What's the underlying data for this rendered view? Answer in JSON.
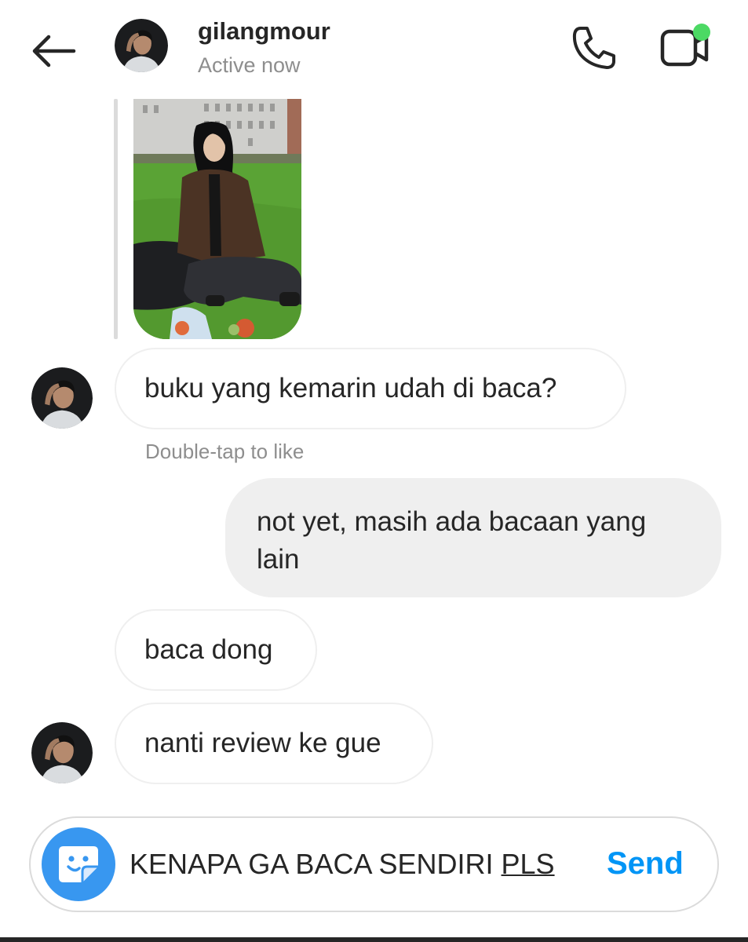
{
  "header": {
    "username": "gilangmour",
    "status": "Active now",
    "icons": {
      "back": "back-arrow-icon",
      "call": "phone-icon",
      "video": "video-camera-icon"
    },
    "online_dot_color": "#4cd964"
  },
  "messages": [
    {
      "sender": "them",
      "type": "image",
      "content": "photo"
    },
    {
      "sender": "them",
      "type": "text",
      "text": "buku yang kemarin udah di baca?"
    },
    {
      "sender": "me",
      "type": "text",
      "text": "not yet, masih ada bacaan yang lain"
    },
    {
      "sender": "them",
      "type": "text",
      "text": "baca dong"
    },
    {
      "sender": "them",
      "type": "text",
      "text": "nanti review ke gue"
    }
  ],
  "hint": "Double-tap to like",
  "composer": {
    "text_main": "KENAPA GA BACA SENDIRI ",
    "text_underlined": "PLS",
    "send_label": "Send",
    "sticker_icon": "sticker-icon"
  },
  "colors": {
    "send_blue": "#0095f6",
    "sticker_blue": "#3897f0",
    "my_bubble": "#efefef",
    "secondary_text": "#8e8e8e"
  }
}
